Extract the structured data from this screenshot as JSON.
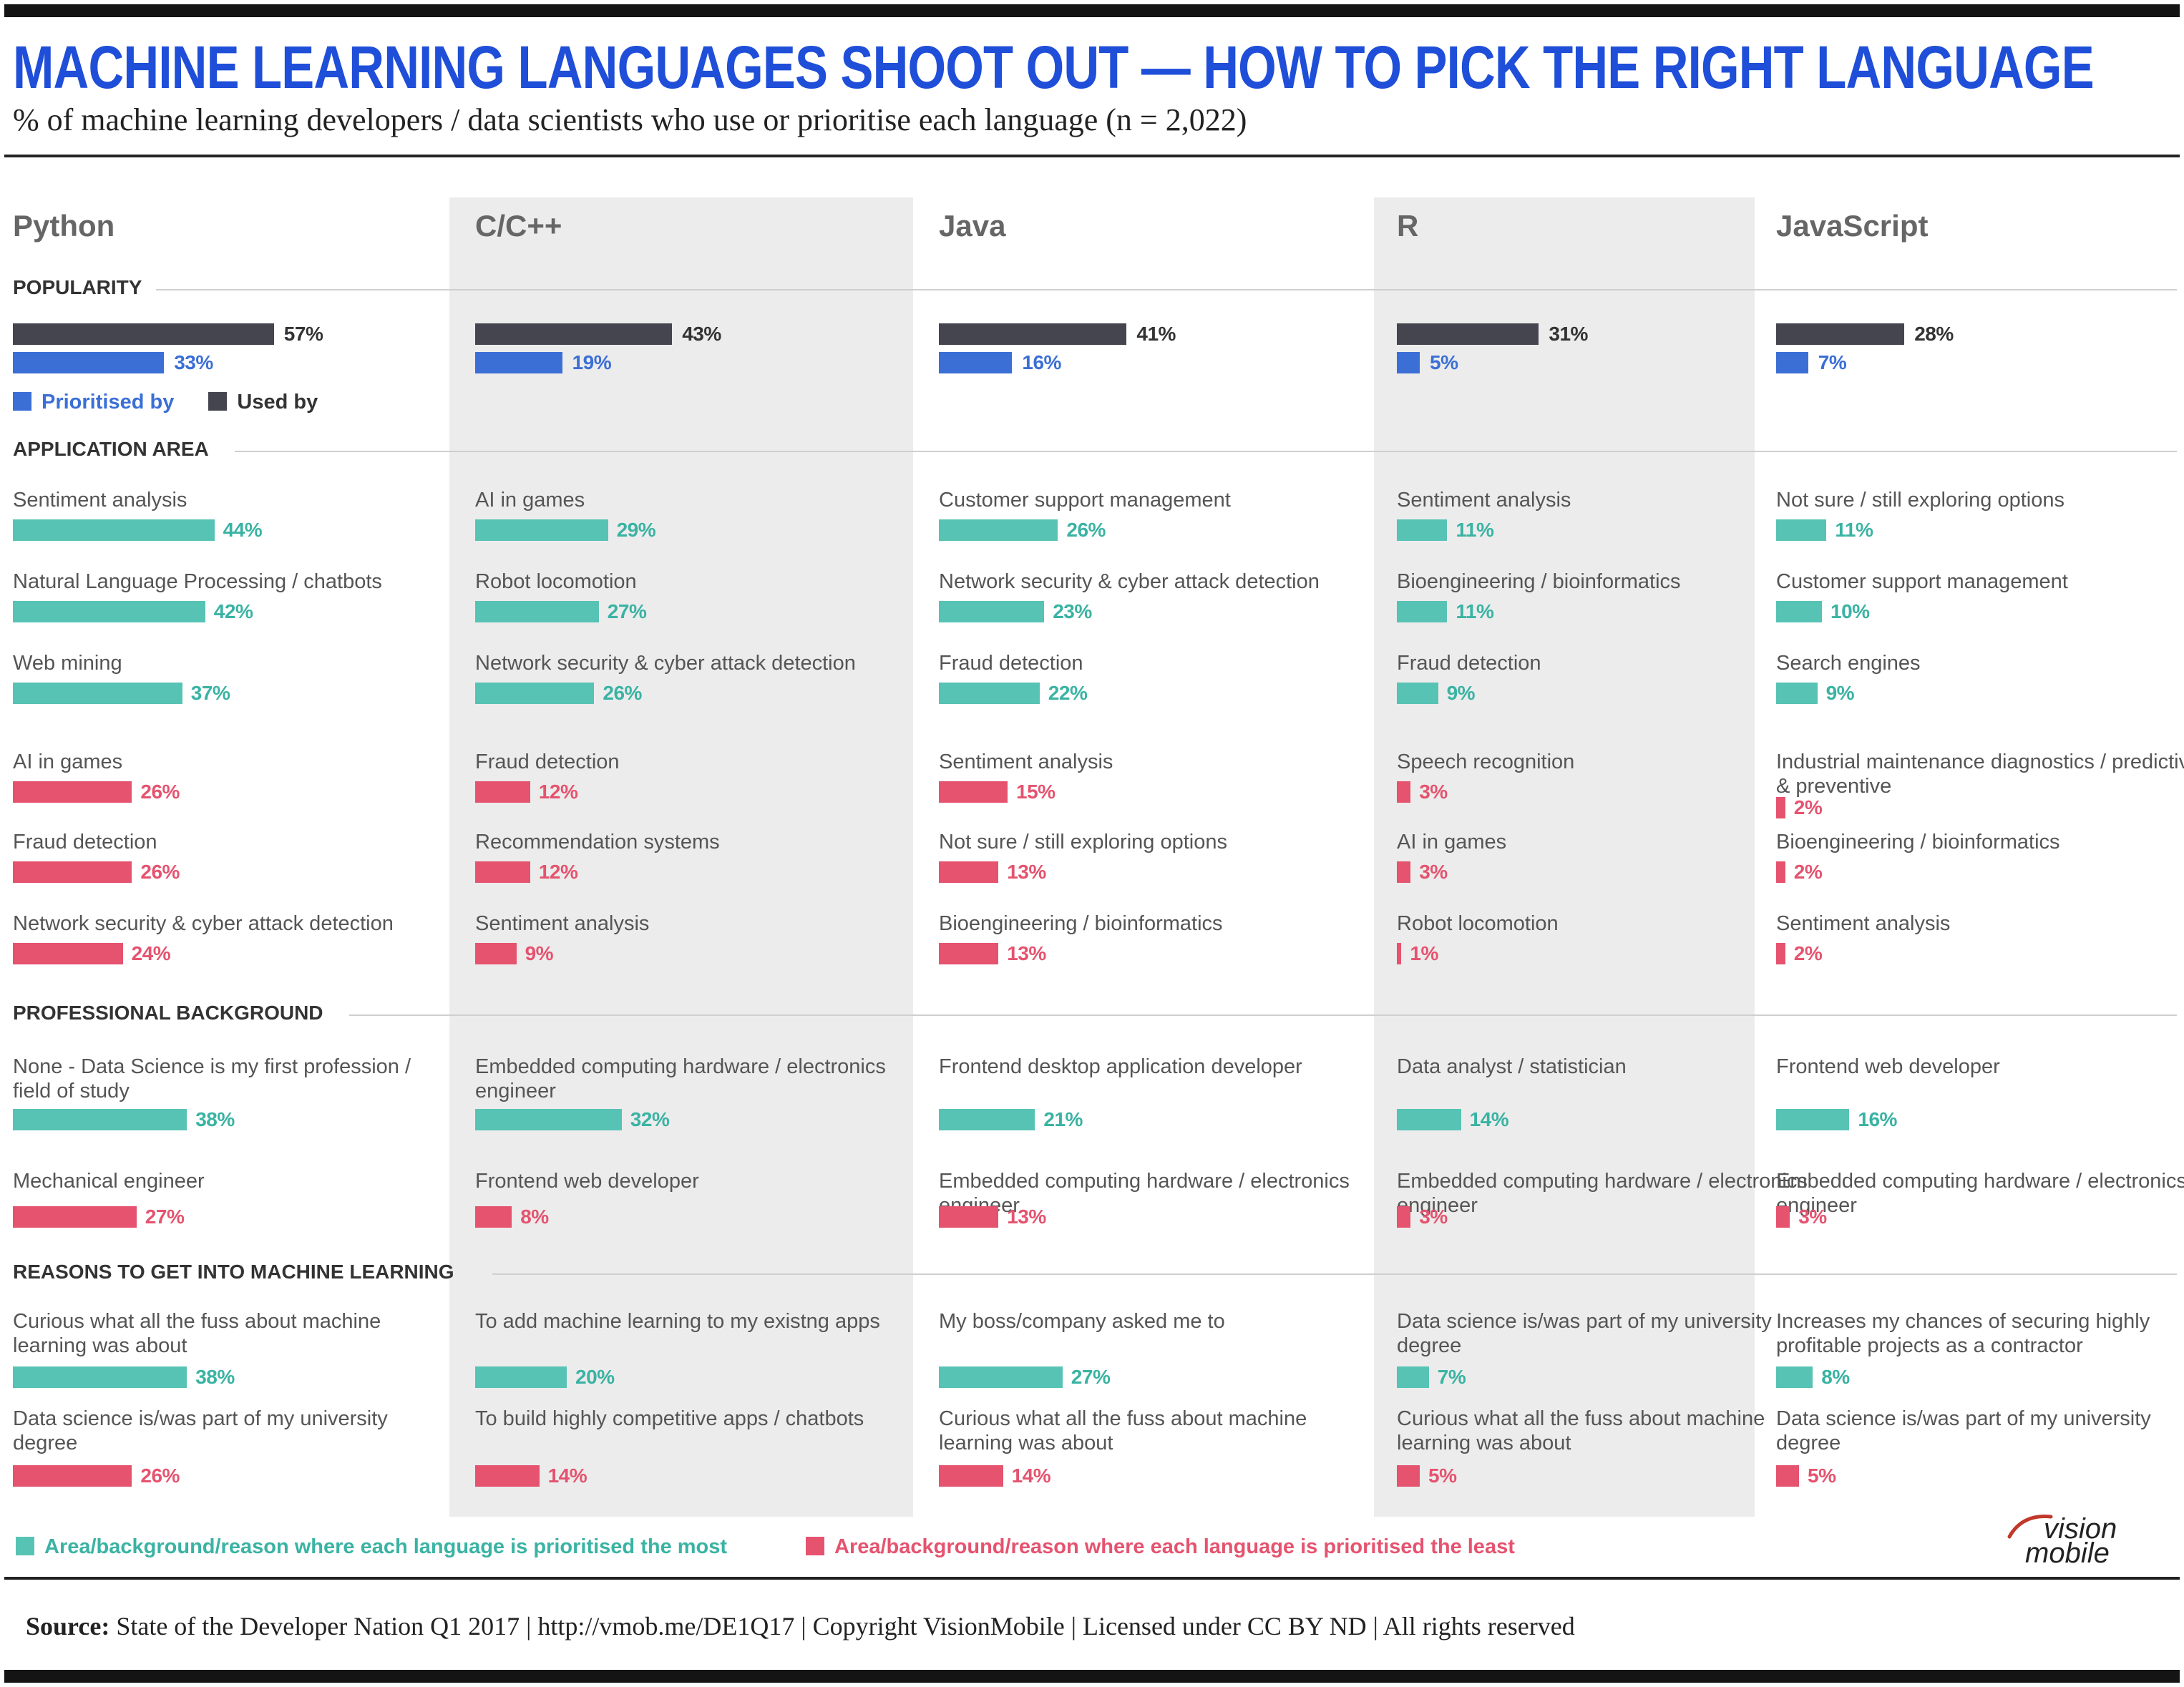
{
  "header": {
    "title": "MACHINE LEARNING LANGUAGES SHOOT OUT —  HOW TO PICK THE RIGHT LANGUAGE",
    "subtitle": "% of machine learning developers / data scientists who use or prioritise each language (n = 2,022)"
  },
  "sections": {
    "popularity": "POPULARITY",
    "application": "APPLICATION AREA",
    "background": "PROFESSIONAL BACKGROUND",
    "reasons": "REASONS TO GET INTO MACHINE LEARNING"
  },
  "popularity_legend": {
    "prioritised": "Prioritised by",
    "used": "Used by"
  },
  "bottom_legend": {
    "most": "Area/background/reason where each language is prioritised the most",
    "least": "Area/background/reason where each language is prioritised the least"
  },
  "footer": {
    "source_label": "Source:",
    "source_text": " State of the Developer Nation Q1 2017   |   http://vmob.me/DE1Q17   |   Copyright VisionMobile   |   Licensed under CC BY ND   |   All rights reserved"
  },
  "logo": {
    "line1": "vision",
    "line2": "mobile"
  },
  "colors": {
    "used": "#454550",
    "prioritised": "#3b6fd6",
    "most": "#57c3b4",
    "least": "#e5536f",
    "title": "#1f4ed8"
  },
  "chart_data": {
    "type": "bar",
    "unit": "%",
    "languages": [
      {
        "name": "Python",
        "popularity": {
          "used": 57,
          "prioritised": 33
        },
        "application": [
          {
            "label": "Sentiment analysis",
            "value": 44,
            "kind": "most"
          },
          {
            "label": "Natural Language Processing / chatbots",
            "value": 42,
            "kind": "most"
          },
          {
            "label": "Web mining",
            "value": 37,
            "kind": "most"
          },
          {
            "label": "AI in games",
            "value": 26,
            "kind": "least"
          },
          {
            "label": "Fraud detection",
            "value": 26,
            "kind": "least"
          },
          {
            "label": "Network security & cyber attack detection",
            "value": 24,
            "kind": "least"
          }
        ],
        "background": [
          {
            "label": "None - Data Science is my first profession / field of study",
            "value": 38,
            "kind": "most"
          },
          {
            "label": "Mechanical engineer",
            "value": 27,
            "kind": "least"
          }
        ],
        "reasons": [
          {
            "label": "Curious what all the fuss about machine learning was about",
            "value": 38,
            "kind": "most"
          },
          {
            "label": "Data science is/was part of my university degree",
            "value": 26,
            "kind": "least"
          }
        ]
      },
      {
        "name": "C/C++",
        "popularity": {
          "used": 43,
          "prioritised": 19
        },
        "application": [
          {
            "label": "AI in games",
            "value": 29,
            "kind": "most"
          },
          {
            "label": "Robot locomotion",
            "value": 27,
            "kind": "most"
          },
          {
            "label": "Network security & cyber attack detection",
            "value": 26,
            "kind": "most"
          },
          {
            "label": "Fraud detection",
            "value": 12,
            "kind": "least"
          },
          {
            "label": "Recommendation systems",
            "value": 12,
            "kind": "least"
          },
          {
            "label": "Sentiment analysis",
            "value": 9,
            "kind": "least"
          }
        ],
        "background": [
          {
            "label": "Embedded computing hardware / electronics engineer",
            "value": 32,
            "kind": "most"
          },
          {
            "label": "Frontend web developer",
            "value": 8,
            "kind": "least"
          }
        ],
        "reasons": [
          {
            "label": "To add machine learning to my existng apps",
            "value": 20,
            "kind": "most"
          },
          {
            "label": "To build highly competitive apps / chatbots",
            "value": 14,
            "kind": "least"
          }
        ]
      },
      {
        "name": "Java",
        "popularity": {
          "used": 41,
          "prioritised": 16
        },
        "application": [
          {
            "label": "Customer support management",
            "value": 26,
            "kind": "most"
          },
          {
            "label": "Network security & cyber attack detection",
            "value": 23,
            "kind": "most"
          },
          {
            "label": "Fraud detection",
            "value": 22,
            "kind": "most"
          },
          {
            "label": "Sentiment analysis",
            "value": 15,
            "kind": "least"
          },
          {
            "label": "Not sure / still exploring options",
            "value": 13,
            "kind": "least"
          },
          {
            "label": "Bioengineering / bioinformatics",
            "value": 13,
            "kind": "least"
          }
        ],
        "background": [
          {
            "label": "Frontend desktop application developer",
            "value": 21,
            "kind": "most"
          },
          {
            "label": "Embedded computing hardware / electronics engineer",
            "value": 13,
            "kind": "least"
          }
        ],
        "reasons": [
          {
            "label": "My boss/company asked me to",
            "value": 27,
            "kind": "most"
          },
          {
            "label": "Curious what all the fuss about machine learning was about",
            "value": 14,
            "kind": "least"
          }
        ]
      },
      {
        "name": "R",
        "popularity": {
          "used": 31,
          "prioritised": 5
        },
        "application": [
          {
            "label": "Sentiment analysis",
            "value": 11,
            "kind": "most"
          },
          {
            "label": "Bioengineering / bioinformatics",
            "value": 11,
            "kind": "most"
          },
          {
            "label": "Fraud detection",
            "value": 9,
            "kind": "most"
          },
          {
            "label": "Speech recognition",
            "value": 3,
            "kind": "least"
          },
          {
            "label": "AI in games",
            "value": 3,
            "kind": "least"
          },
          {
            "label": "Robot locomotion",
            "value": 1,
            "kind": "least"
          }
        ],
        "background": [
          {
            "label": "Data analyst / statistician",
            "value": 14,
            "kind": "most"
          },
          {
            "label": "Embedded computing hardware / electronics engineer",
            "value": 3,
            "kind": "least"
          }
        ],
        "reasons": [
          {
            "label": "Data science is/was part of my university degree",
            "value": 7,
            "kind": "most"
          },
          {
            "label": "Curious what all the fuss about machine learning was about",
            "value": 5,
            "kind": "least"
          }
        ]
      },
      {
        "name": "JavaScript",
        "popularity": {
          "used": 28,
          "prioritised": 7
        },
        "application": [
          {
            "label": "Not sure / still exploring options",
            "value": 11,
            "kind": "most"
          },
          {
            "label": "Customer support management",
            "value": 10,
            "kind": "most"
          },
          {
            "label": "Search engines",
            "value": 9,
            "kind": "most"
          },
          {
            "label": "Industrial maintenance diagnostics / predictive & preventive",
            "value": 2,
            "kind": "least"
          },
          {
            "label": "Bioengineering / bioinformatics",
            "value": 2,
            "kind": "least"
          },
          {
            "label": "Sentiment analysis",
            "value": 2,
            "kind": "least"
          }
        ],
        "background": [
          {
            "label": "Frontend web developer",
            "value": 16,
            "kind": "most"
          },
          {
            "label": "Embedded computing hardware / electronics engineer",
            "value": 3,
            "kind": "least"
          }
        ],
        "reasons": [
          {
            "label": "Increases my chances of securing highly profitable projects as a contractor",
            "value": 8,
            "kind": "most"
          },
          {
            "label": "Data science is/was part of my university degree",
            "value": 5,
            "kind": "least"
          }
        ]
      }
    ]
  }
}
